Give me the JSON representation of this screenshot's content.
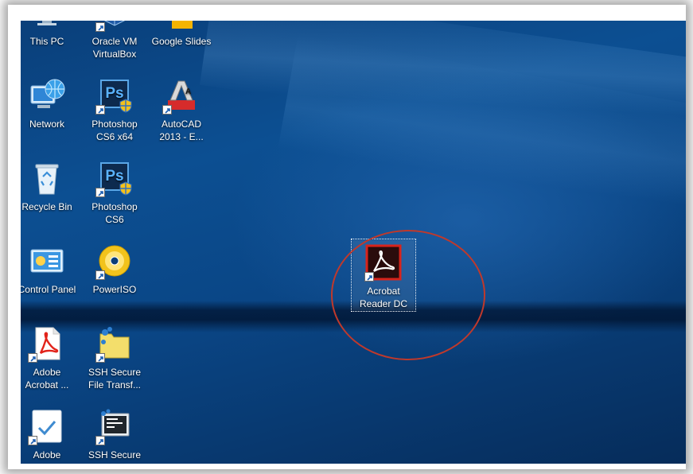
{
  "desktop": {
    "icons": [
      {
        "id": "this-pc",
        "label": "This PC",
        "icon": "computer-icon"
      },
      {
        "id": "oracle-vm",
        "label": "Oracle VM\nVirtualBox",
        "icon": "virtualbox-icon"
      },
      {
        "id": "google-slides",
        "label": "Google Slides",
        "icon": "google-slides-icon"
      },
      {
        "id": "network",
        "label": "Network",
        "icon": "network-icon"
      },
      {
        "id": "photoshop-x64",
        "label": "Photoshop\nCS6 x64",
        "icon": "photoshop-icon"
      },
      {
        "id": "autocad",
        "label": "AutoCAD\n2013 - E...",
        "icon": "autocad-icon"
      },
      {
        "id": "recycle-bin",
        "label": "Recycle Bin",
        "icon": "recycle-bin-icon"
      },
      {
        "id": "photoshop",
        "label": "Photoshop\nCS6",
        "icon": "photoshop-icon"
      },
      {
        "id": "control-panel",
        "label": "Control Panel",
        "icon": "control-panel-icon"
      },
      {
        "id": "poweriso",
        "label": "PowerISO",
        "icon": "disc-icon"
      },
      {
        "id": "adobe-acrobat",
        "label": "Adobe\nAcrobat ...",
        "icon": "acrobat-icon"
      },
      {
        "id": "ssh-file",
        "label": "SSH Secure\nFile Transf...",
        "icon": "ssh-file-transfer-icon"
      },
      {
        "id": "adobe-app",
        "label": "Adobe\nApp Central",
        "icon": "adobe-app-icon"
      },
      {
        "id": "ssh-shell",
        "label": "SSH Secure\nShell Client",
        "icon": "ssh-shell-icon"
      },
      {
        "id": "acrobat-reader",
        "label": "Acrobat\nReader DC",
        "icon": "acrobat-reader-dc-icon"
      }
    ],
    "highlight_color": "#c0392b"
  }
}
